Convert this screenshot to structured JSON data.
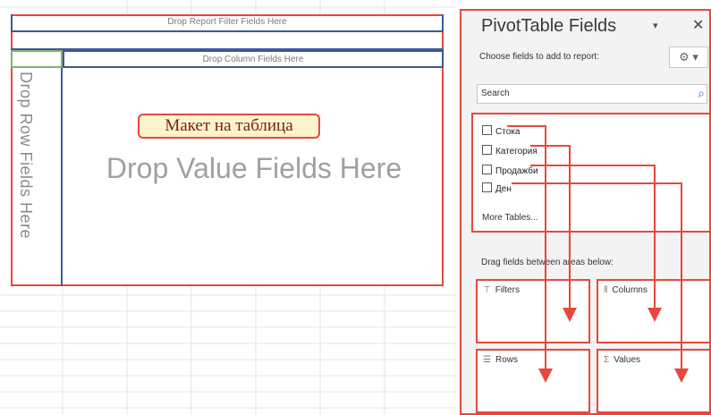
{
  "pivot": {
    "filter_zone_text": "Drop Report Filter Fields Here",
    "column_zone_text": "Drop Column Fields Here",
    "row_zone_text": "Drop Row Fields Here",
    "value_zone_text": "Drop Value Fields Here",
    "layout_label": "Макет на таблица"
  },
  "panel": {
    "title": "PivotTable Fields",
    "choose_label": "Choose fields to add to report:",
    "gear_symbol": "⚙ ▾",
    "search_placeholder": "Search",
    "fields": [
      "Стока",
      "Категория",
      "Продажби",
      "Ден"
    ],
    "more_tables": "More Tables...",
    "drag_label": "Drag fields between areas below:",
    "areas": {
      "filters": "Filters",
      "columns": "Columns",
      "rows": "Rows",
      "values": "Values"
    }
  },
  "colors": {
    "highlight": "#e8473f",
    "zone_border": "#3b5998",
    "layout_label_bg": "#fdf4cd"
  }
}
